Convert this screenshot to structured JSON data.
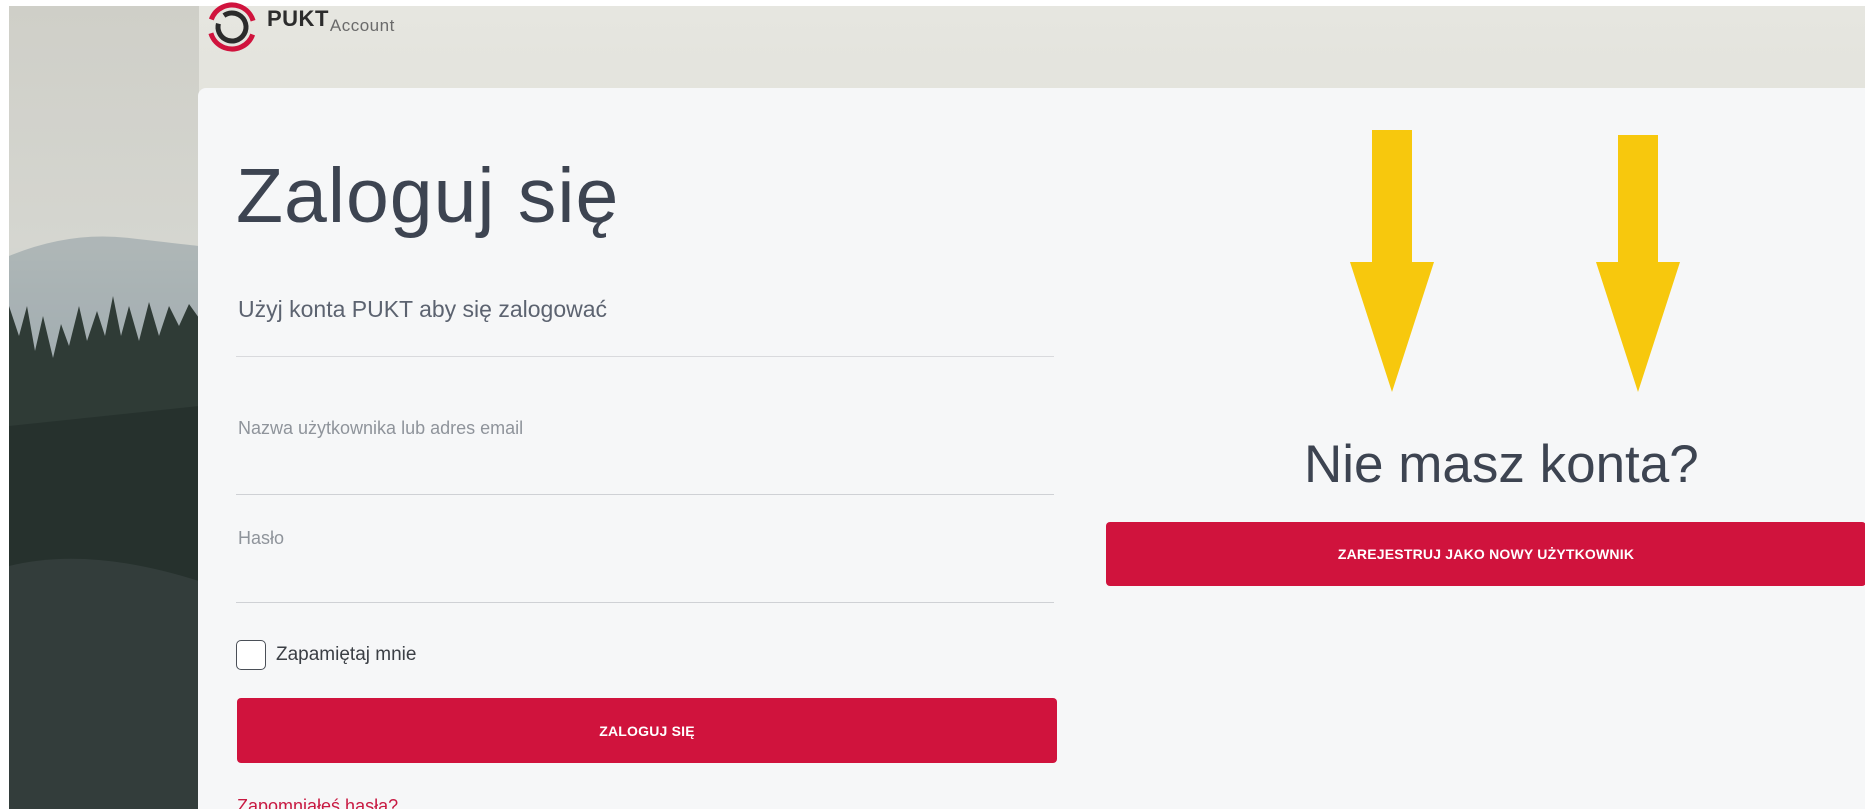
{
  "header": {
    "brand": "PUKT",
    "brand_sub": "Account"
  },
  "login": {
    "title": "Zaloguj się",
    "subtitle": "Użyj konta PUKT aby się zalogować",
    "username_label": "Nazwa użytkownika lub adres email",
    "username_value": "",
    "password_label": "Hasło",
    "password_value": "",
    "remember_label": "Zapamiętaj mnie",
    "remember_checked": false,
    "submit_label": "ZALOGUJ SIĘ",
    "forgot_label": "Zapomniałeś hasła?"
  },
  "register": {
    "heading": "Nie masz konta?",
    "button_label": "ZAREJESTRUJ JAKO NOWY UŻYTKOWNIK"
  },
  "annotations": {
    "arrow_color": "#f7c80d",
    "arrow_count": 2
  },
  "colors": {
    "accent": "#d0133d",
    "card_bg": "#f6f7f8",
    "heading": "#3d4451"
  }
}
